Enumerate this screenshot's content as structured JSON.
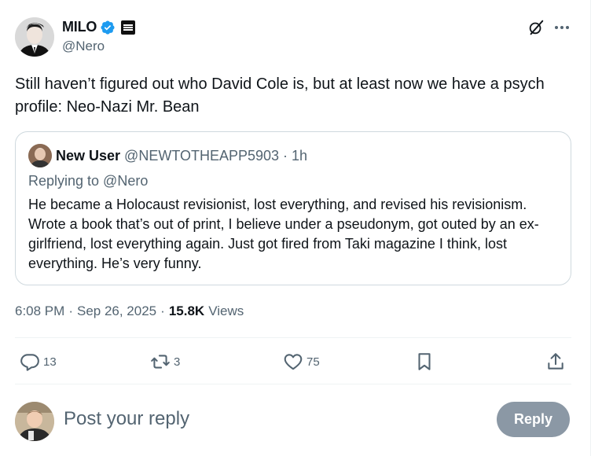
{
  "author": {
    "name": "MILO",
    "handle": "@Nero"
  },
  "icons": {
    "verified": "verified-badge-icon",
    "affiliation": "affiliate-badge-icon",
    "grok": "grok-icon",
    "more": "more-icon"
  },
  "tweet": {
    "text": "Still haven’t figured out who David Cole is, but at least now we have a psych profile: Neo-Nazi Mr. Bean"
  },
  "quote": {
    "name": "New User",
    "handle": "@NEWTOTHEAPP5903",
    "separator": "·",
    "time": "1h",
    "replying_to": "Replying to @Nero",
    "body": "He became a Holocaust revisionist, lost everything, and revised his revisionism.  Wrote a book that’s out of print, I believe under a pseudonym, got outed by an ex-girlfriend, lost everything again. Just got fired from Taki magazine I think, lost everything.  He’s very funny."
  },
  "meta": {
    "time": "6:08 PM",
    "sep1": "·",
    "date": "Sep 26, 2025",
    "sep2": "·",
    "views_count": "15.8K",
    "views_label": "Views"
  },
  "actions": {
    "replies": "13",
    "reposts": "3",
    "likes": "75"
  },
  "reply_box": {
    "placeholder": "Post your reply",
    "button_label": "Reply"
  },
  "colors": {
    "accent": "#1d9bf0",
    "muted": "#536471",
    "reply_button_disabled": "#8b98a5",
    "border": "#cfd9de"
  }
}
